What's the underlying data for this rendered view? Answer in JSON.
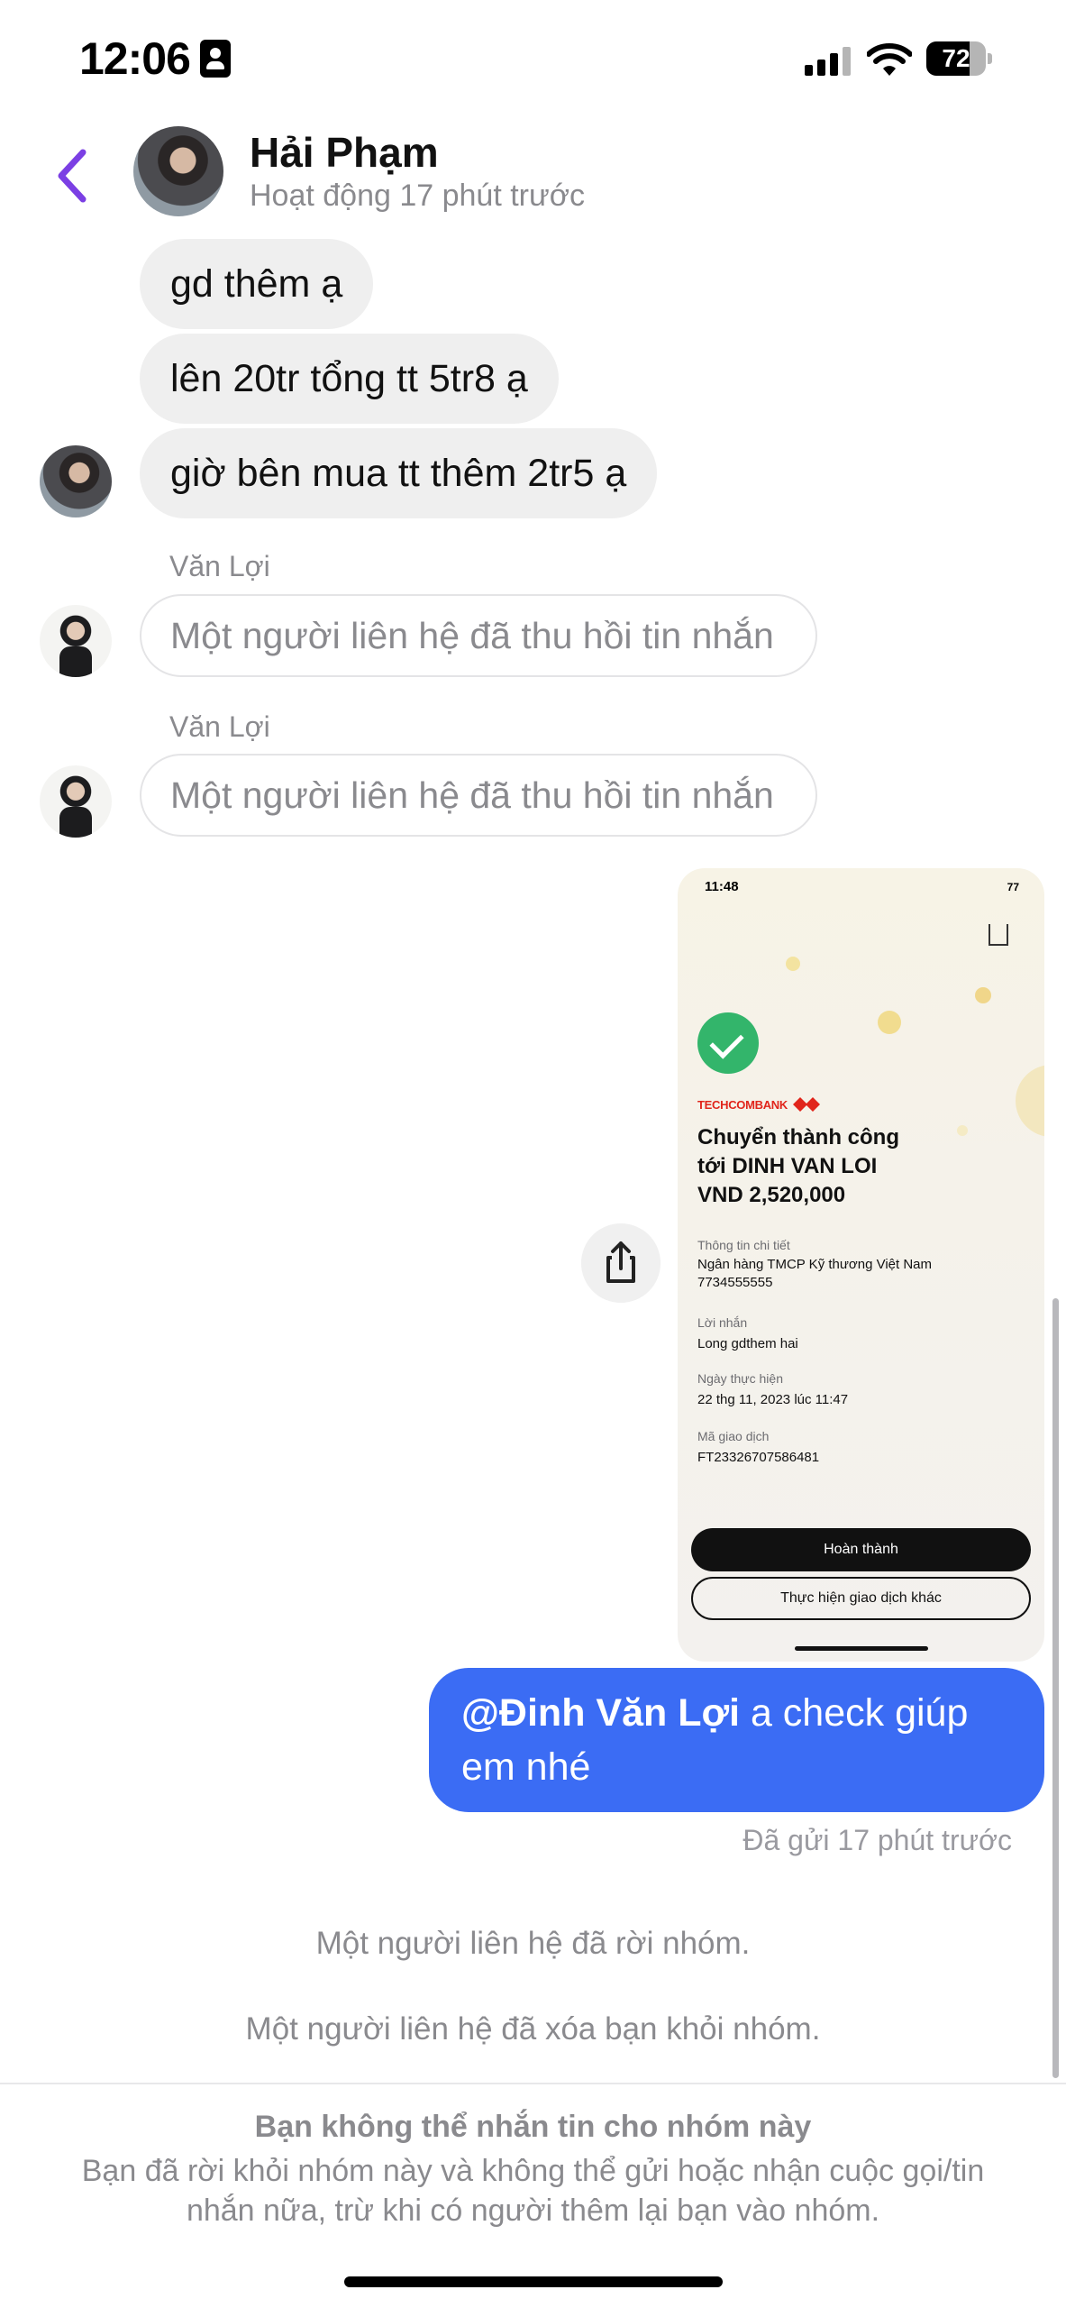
{
  "status_bar": {
    "time": "12:06",
    "battery": "72",
    "battery_level": 0.72
  },
  "header": {
    "contact_name": "Hải Phạm",
    "activity_status": "Hoạt động 17 phút trước"
  },
  "messages": [
    {
      "text": "gd thêm ạ"
    },
    {
      "text": "lên 20tr tổng tt 5tr8 ạ"
    },
    {
      "text": "giờ bên mua tt thêm 2tr5 ạ"
    }
  ],
  "recalled": [
    {
      "sender": "Văn Lợi",
      "text": "Một người liên hệ đã thu hồi tin nhắn"
    },
    {
      "sender": "Văn Lợi",
      "text": "Một người liên hệ đã thu hồi tin nhắn"
    }
  ],
  "shared_image": {
    "time": "11:48",
    "status": "77",
    "bank": "TECHCOMBANK",
    "title_line1": "Chuyển thành công",
    "title_line2": "tới DINH VAN LOI",
    "title_line3": "VND 2,520,000",
    "details_label": "Thông tin chi tiết",
    "details_bank": "Ngân hàng TMCP Kỹ thương Việt Nam",
    "details_account": "7734555555",
    "message_label": "Lời nhắn",
    "message_value": "Long gdthem hai",
    "date_label": "Ngày thực hiện",
    "date_value": "22 thg 11, 2023 lúc 11:47",
    "code_label": "Mã giao dịch",
    "code_value": "FT23326707586481",
    "primary_button": "Hoàn thành",
    "secondary_button": "Thực hiện giao dịch khác"
  },
  "outgoing": {
    "mention": "@Đinh Văn Lợi",
    "text": " a check giúp em nhé",
    "status": "Đã gửi 17 phút trước"
  },
  "system": [
    "Một người liên hệ đã rời nhóm.",
    "Một người liên hệ đã xóa bạn khỏi nhóm."
  ],
  "footer": {
    "heading": "Bạn không thể nhắn tin cho nhóm này",
    "body": "Bạn đã rời khỏi nhóm này và không thể gửi hoặc nhận cuộc gọi/tin nhắn nữa, trừ khi có người thêm lại bạn vào nhóm."
  },
  "colors": {
    "accent": "#3b6cf4",
    "back_arrow": "#7b3fe4",
    "incoming_bubble": "#efefef",
    "success": "#33b56b",
    "bank_red": "#e1251b"
  },
  "icons": {
    "back": "chevron-left-icon",
    "share": "share-icon",
    "check": "check-icon"
  }
}
